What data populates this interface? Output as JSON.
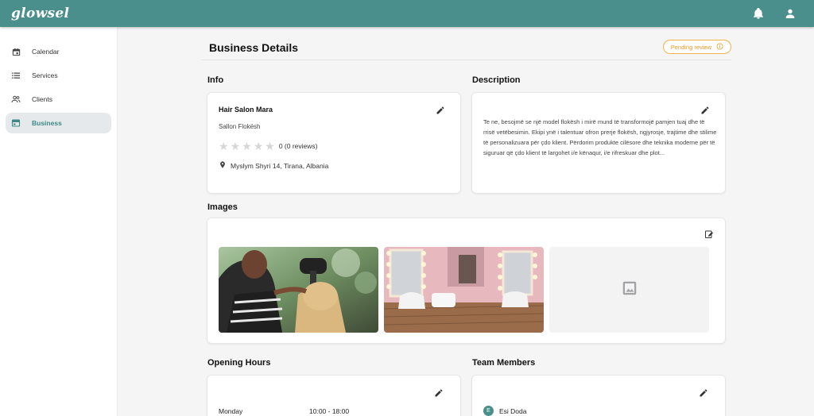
{
  "app": {
    "logo": "glowsel"
  },
  "topbar": {
    "notifications_icon": "bell-icon",
    "account_icon": "user-icon"
  },
  "sidebar": {
    "items": [
      {
        "label": "Calendar",
        "icon": "calendar-icon",
        "active": false
      },
      {
        "label": "Services",
        "icon": "list-icon",
        "active": false
      },
      {
        "label": "Clients",
        "icon": "users-icon",
        "active": false
      },
      {
        "label": "Business",
        "icon": "storefront-icon",
        "active": true
      }
    ]
  },
  "page": {
    "title": "Business Details",
    "status_badge": "Pending review"
  },
  "info": {
    "section_title": "Info",
    "name": "Hair Salon Mara",
    "category": "Sallon Flokësh",
    "rating": 0,
    "max_rating": 5,
    "reviews_label": "0 (0 reviews)",
    "address": "Myslym Shyri 14, Tirana, Albania"
  },
  "description": {
    "section_title": "Description",
    "text": "Te ne, besojmë se një model flokësh i mirë mund të transformojë pamjen tuaj dhe të rrisë vetëbesimin. Ekipi ynë i talentuar ofron prerje flokësh, ngjyrosje, trajtime dhe stilime të personalizuara për çdo klient. Përdorim produkte cilësore dhe teknika moderne për të siguruar që çdo klient të largohet i/e kënaqur, i/e rifreskuar dhe plot..."
  },
  "images": {
    "section_title": "Images",
    "items": [
      "hairdresser-photo",
      "salon-interior-photo",
      "image-placeholder-icon"
    ]
  },
  "opening_hours": {
    "section_title": "Opening Hours",
    "rows": [
      {
        "day": "Monday",
        "hours": "10:00 - 18:00"
      }
    ]
  },
  "team": {
    "section_title": "Team Members",
    "members": [
      {
        "initial": "E",
        "name": "Esi Doda"
      }
    ]
  },
  "colors": {
    "brand": "#4a8f8b",
    "pending": "#e79a24",
    "active_bg": "#e6e9ec"
  }
}
